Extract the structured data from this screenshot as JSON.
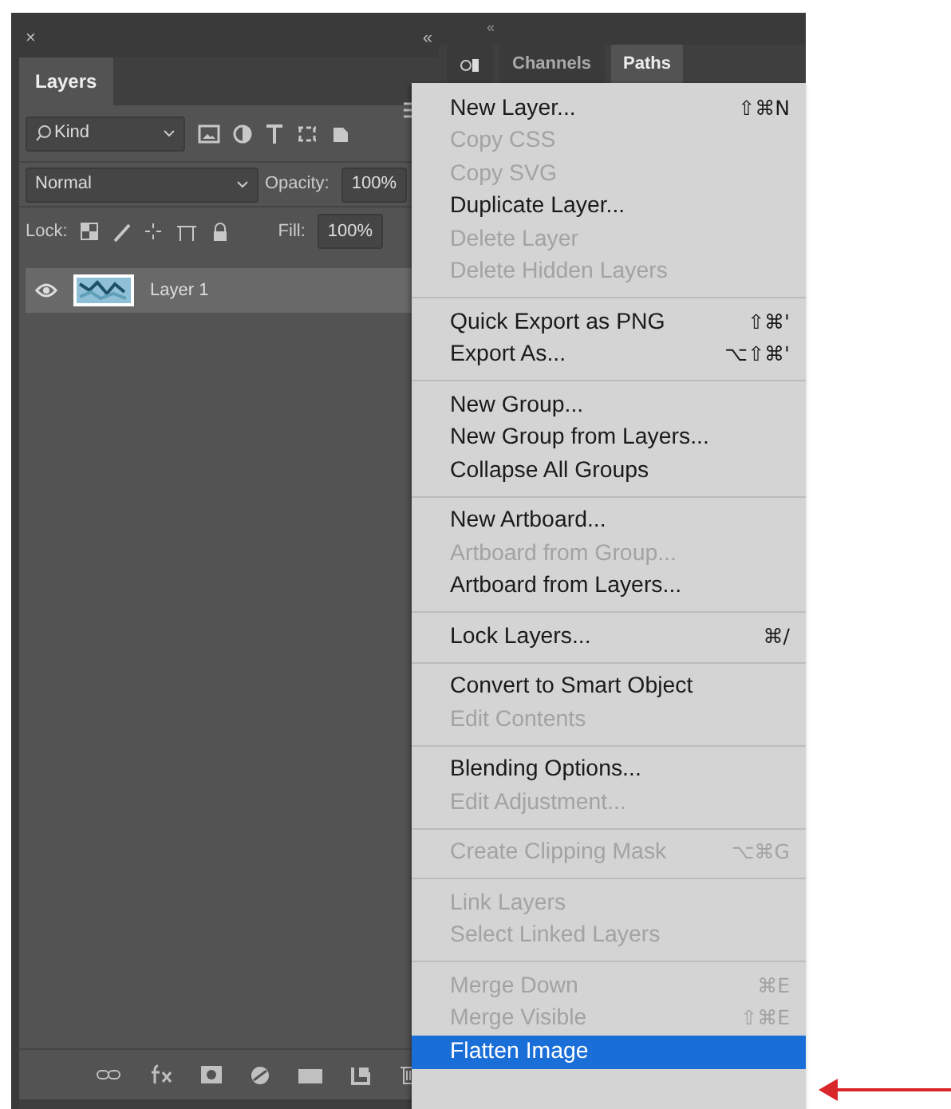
{
  "layers_panel": {
    "close_glyph": "×",
    "collapse_glyph": "«",
    "tabs": [
      {
        "label": "Layers",
        "selected": true
      }
    ],
    "filter": {
      "value": "Kind"
    },
    "blend_mode": "Normal",
    "opacity_label": "Opacity:",
    "opacity": "100%",
    "lock_label": "Lock:",
    "fill_label": "Fill:",
    "fill": "100%",
    "layers": [
      {
        "name": "Layer 1",
        "visible": true,
        "selected": true
      }
    ]
  },
  "side_panel": {
    "collapse_glyph": "«",
    "tabs": [
      {
        "kind": "icon",
        "selected": false
      },
      {
        "kind": "text",
        "label": "Channels",
        "selected": false
      },
      {
        "kind": "text",
        "label": "Paths",
        "selected": true
      }
    ]
  },
  "menu": {
    "groups": [
      [
        {
          "label": "New Layer...",
          "shortcut": "⇧⌘N",
          "disabled": false,
          "selected": false
        },
        {
          "label": "Copy CSS",
          "disabled": true,
          "selected": false
        },
        {
          "label": "Copy SVG",
          "disabled": true,
          "selected": false
        },
        {
          "label": "Duplicate Layer...",
          "disabled": false,
          "selected": false
        },
        {
          "label": "Delete Layer",
          "disabled": true,
          "selected": false
        },
        {
          "label": "Delete Hidden Layers",
          "disabled": true,
          "selected": false
        }
      ],
      [
        {
          "label": "Quick Export as PNG",
          "shortcut": "⇧⌘'",
          "disabled": false,
          "selected": false
        },
        {
          "label": "Export As...",
          "shortcut": "⌥⇧⌘'",
          "disabled": false,
          "selected": false
        }
      ],
      [
        {
          "label": "New Group...",
          "disabled": false,
          "selected": false
        },
        {
          "label": "New Group from Layers...",
          "disabled": false,
          "selected": false
        },
        {
          "label": "Collapse All Groups",
          "disabled": false,
          "selected": false
        }
      ],
      [
        {
          "label": "New Artboard...",
          "disabled": false,
          "selected": false
        },
        {
          "label": "Artboard from Group...",
          "disabled": true,
          "selected": false
        },
        {
          "label": "Artboard from Layers...",
          "disabled": false,
          "selected": false
        }
      ],
      [
        {
          "label": "Lock Layers...",
          "shortcut": "⌘/",
          "disabled": false,
          "selected": false
        }
      ],
      [
        {
          "label": "Convert to Smart Object",
          "disabled": false,
          "selected": false
        },
        {
          "label": "Edit Contents",
          "disabled": true,
          "selected": false
        }
      ],
      [
        {
          "label": "Blending Options...",
          "disabled": false,
          "selected": false
        },
        {
          "label": "Edit Adjustment...",
          "disabled": true,
          "selected": false
        }
      ],
      [
        {
          "label": "Create Clipping Mask",
          "shortcut": "⌥⌘G",
          "disabled": true,
          "selected": false
        }
      ],
      [
        {
          "label": "Link Layers",
          "disabled": true,
          "selected": false
        },
        {
          "label": "Select Linked Layers",
          "disabled": true,
          "selected": false
        }
      ],
      [
        {
          "label": "Merge Down",
          "shortcut": "⌘E",
          "disabled": true,
          "selected": false
        },
        {
          "label": "Merge Visible",
          "shortcut": "⇧⌘E",
          "disabled": true,
          "selected": false
        },
        {
          "label": "Flatten Image",
          "disabled": false,
          "selected": true
        }
      ]
    ]
  }
}
